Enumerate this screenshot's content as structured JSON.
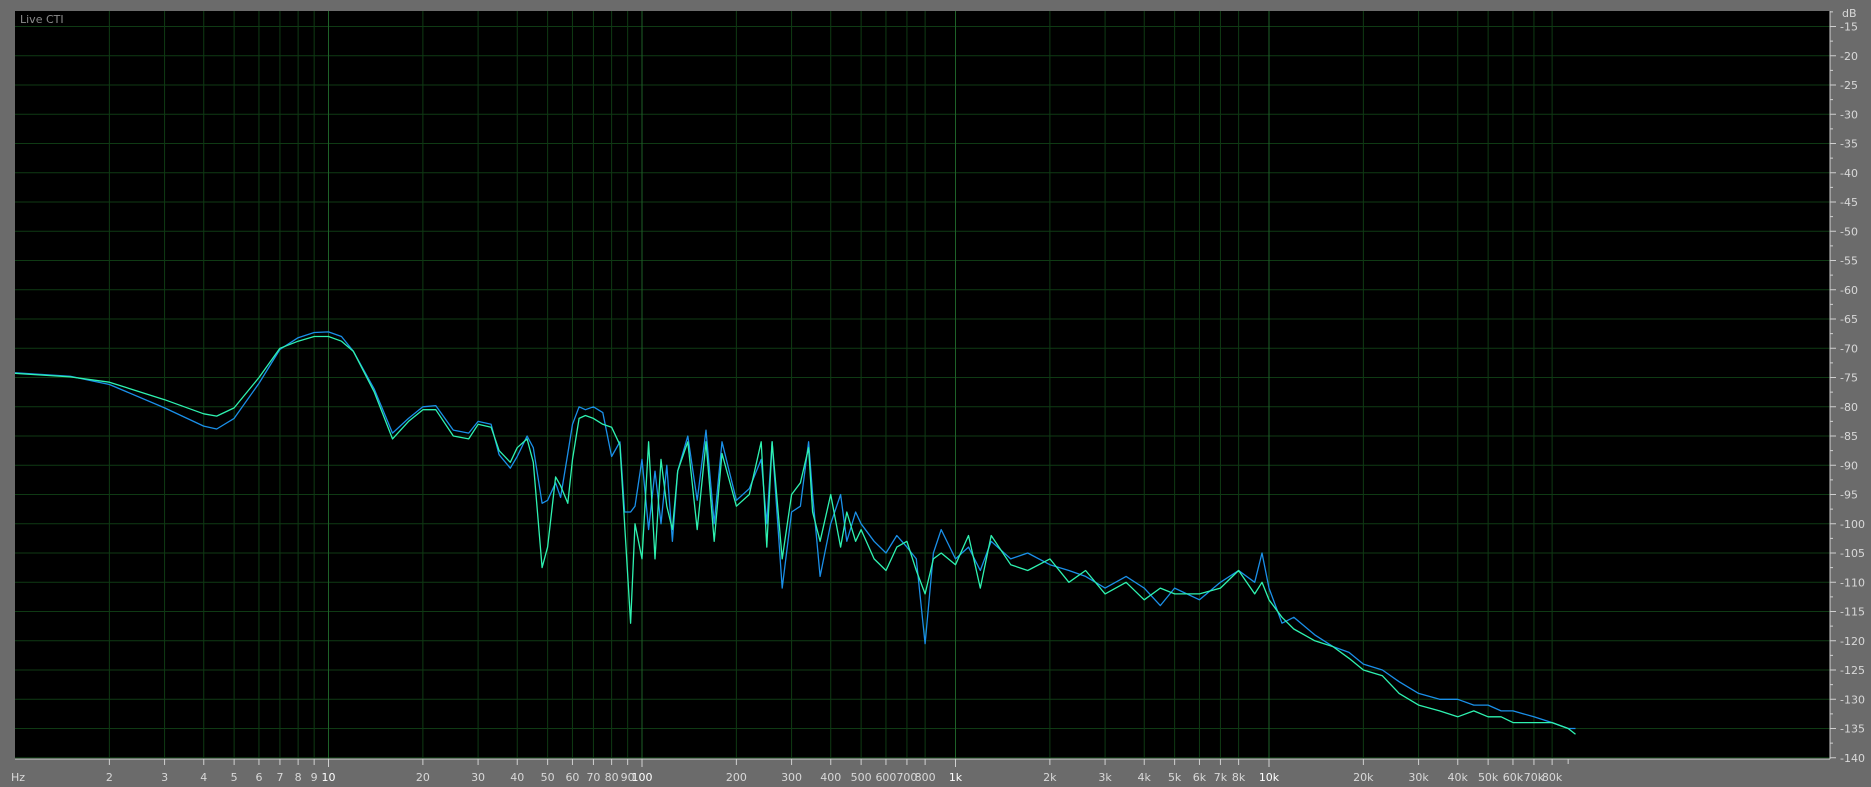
{
  "panel": {
    "mode_label": "Live CTI"
  },
  "colors": {
    "background": "#000000",
    "frame": "#6b6b6b",
    "grid_minor": "#0f3a14",
    "grid_major": "#1e6128",
    "axis_text": "#d8d8d8",
    "series_left": "#1a8fe8",
    "series_right": "#2ef2b0"
  },
  "chart_data": {
    "type": "line",
    "xscale": "log",
    "xunit_label": "Hz",
    "yunit_label": "dB",
    "xlim": [
      1,
      100000
    ],
    "ylim": [
      -140,
      -12
    ],
    "grid": true,
    "x_ticks": [
      {
        "value": 2,
        "label": "2"
      },
      {
        "value": 3,
        "label": "3"
      },
      {
        "value": 4,
        "label": "4"
      },
      {
        "value": 5,
        "label": "5"
      },
      {
        "value": 6,
        "label": "6"
      },
      {
        "value": 7,
        "label": "7"
      },
      {
        "value": 8,
        "label": "8"
      },
      {
        "value": 9,
        "label": "9"
      },
      {
        "value": 10,
        "label": "10",
        "major": true
      },
      {
        "value": 20,
        "label": "20"
      },
      {
        "value": 30,
        "label": "30"
      },
      {
        "value": 40,
        "label": "40"
      },
      {
        "value": 50,
        "label": "50"
      },
      {
        "value": 60,
        "label": "60"
      },
      {
        "value": 70,
        "label": "70"
      },
      {
        "value": 80,
        "label": "80"
      },
      {
        "value": 90,
        "label": "90"
      },
      {
        "value": 100,
        "label": "100",
        "major": true
      },
      {
        "value": 200,
        "label": "200"
      },
      {
        "value": 300,
        "label": "300"
      },
      {
        "value": 400,
        "label": "400"
      },
      {
        "value": 500,
        "label": "500"
      },
      {
        "value": 600,
        "label": "600"
      },
      {
        "value": 700,
        "label": "700"
      },
      {
        "value": 800,
        "label": "800"
      },
      {
        "value": 1000,
        "label": "1k",
        "major": true
      },
      {
        "value": 2000,
        "label": "2k"
      },
      {
        "value": 3000,
        "label": "3k"
      },
      {
        "value": 4000,
        "label": "4k"
      },
      {
        "value": 5000,
        "label": "5k"
      },
      {
        "value": 6000,
        "label": "6k"
      },
      {
        "value": 7000,
        "label": "7k"
      },
      {
        "value": 8000,
        "label": "8k"
      },
      {
        "value": 10000,
        "label": "10k",
        "major": true
      },
      {
        "value": 20000,
        "label": "20k"
      },
      {
        "value": 30000,
        "label": "30k"
      },
      {
        "value": 40000,
        "label": "40k"
      },
      {
        "value": 50000,
        "label": "50k"
      },
      {
        "value": 60000,
        "label": "60k"
      },
      {
        "value": 70000,
        "label": "70k"
      },
      {
        "value": 80000,
        "label": "80k"
      }
    ],
    "y_ticks": [
      -15,
      -20,
      -25,
      -30,
      -35,
      -40,
      -45,
      -50,
      -55,
      -60,
      -65,
      -70,
      -75,
      -80,
      -85,
      -90,
      -95,
      -100,
      -105,
      -110,
      -115,
      -120,
      -125,
      -130,
      -135,
      -140
    ],
    "series": [
      {
        "color": "#1a8fe8",
        "x": [
          1,
          1.5,
          2,
          3,
          4,
          4.4,
          5,
          6,
          7,
          8,
          9,
          10,
          11,
          12,
          14,
          16,
          18,
          20,
          22,
          25,
          28,
          30,
          33,
          35,
          38,
          40,
          43,
          45,
          48,
          50,
          53,
          55,
          58,
          60,
          63,
          66,
          70,
          75,
          80,
          85,
          88,
          92,
          95,
          100,
          105,
          110,
          115,
          120,
          125,
          130,
          140,
          150,
          160,
          170,
          180,
          200,
          220,
          240,
          250,
          260,
          280,
          300,
          320,
          340,
          350,
          370,
          400,
          430,
          450,
          480,
          500,
          550,
          600,
          650,
          700,
          750,
          800,
          850,
          900,
          1000,
          1100,
          1200,
          1300,
          1500,
          1700,
          2000,
          2300,
          2600,
          3000,
          3500,
          4000,
          4500,
          5000,
          6000,
          7000,
          8000,
          9000,
          9500,
          10000,
          11000,
          12000,
          14000,
          16000,
          18000,
          20000,
          23000,
          26000,
          30000,
          35000,
          40000,
          45000,
          50000,
          55000,
          60000,
          70000,
          80000,
          90000,
          95000
        ],
        "y": [
          -74.2,
          -74.8,
          -76.2,
          -80.2,
          -83.3,
          -83.8,
          -82,
          -76,
          -70.2,
          -68.2,
          -67.3,
          -67.2,
          -68,
          -70.5,
          -77,
          -84.5,
          -82,
          -80,
          -79.8,
          -84,
          -84.5,
          -82.5,
          -83,
          -88.2,
          -90.5,
          -88.5,
          -85,
          -87,
          -96.5,
          -96,
          -93,
          -95.5,
          -88,
          -83,
          -80,
          -80.5,
          -80,
          -81,
          -88.5,
          -86,
          -98,
          -98,
          -97,
          -89,
          -101,
          -91,
          -100,
          -90,
          -103,
          -91,
          -85,
          -96,
          -84,
          -100,
          -86,
          -96,
          -94,
          -89,
          -100,
          -86,
          -111,
          -98,
          -97,
          -86,
          -95,
          -109,
          -100,
          -95,
          -103,
          -98,
          -100,
          -103,
          -105,
          -102,
          -104,
          -106,
          -120.5,
          -105,
          -101,
          -106,
          -104,
          -108,
          -103,
          -106,
          -105,
          -107,
          -108,
          -109,
          -111,
          -109,
          -111,
          -114,
          -111,
          -113,
          -110,
          -108,
          -110,
          -105,
          -111,
          -117,
          -116,
          -119,
          -121,
          -122,
          -124,
          -125,
          -127,
          -129,
          -130,
          -130,
          -131,
          -131,
          -132,
          -132,
          -133,
          -134,
          -135,
          -135
        ]
      },
      {
        "color": "#2ef2b0",
        "x": [
          1,
          1.5,
          2,
          3,
          4,
          4.4,
          5,
          6,
          7,
          8,
          9,
          10,
          11,
          12,
          14,
          16,
          18,
          20,
          22,
          25,
          28,
          30,
          33,
          35,
          38,
          40,
          43,
          45,
          48,
          50,
          53,
          55,
          58,
          60,
          63,
          66,
          70,
          75,
          80,
          85,
          88,
          92,
          95,
          100,
          105,
          110,
          115,
          120,
          125,
          130,
          140,
          150,
          160,
          170,
          180,
          200,
          220,
          240,
          250,
          260,
          280,
          300,
          320,
          340,
          350,
          370,
          400,
          430,
          450,
          480,
          500,
          550,
          600,
          650,
          700,
          750,
          800,
          850,
          900,
          1000,
          1100,
          1200,
          1300,
          1500,
          1700,
          2000,
          2300,
          2600,
          3000,
          3500,
          4000,
          4500,
          5000,
          6000,
          7000,
          8000,
          9000,
          9500,
          10000,
          11000,
          12000,
          14000,
          16000,
          18000,
          20000,
          23000,
          26000,
          30000,
          35000,
          40000,
          45000,
          50000,
          55000,
          60000,
          70000,
          80000,
          90000,
          95000
        ],
        "y": [
          -74.3,
          -74.9,
          -75.8,
          -78.8,
          -81.2,
          -81.6,
          -80.2,
          -75,
          -70,
          -68.8,
          -68,
          -68,
          -68.8,
          -70.5,
          -77.5,
          -85.5,
          -82.5,
          -80.5,
          -80.5,
          -85,
          -85.5,
          -83,
          -83.5,
          -87.5,
          -89.5,
          -87,
          -85.5,
          -89.5,
          -107.5,
          -104,
          -92,
          -93.5,
          -96.5,
          -89,
          -82,
          -81.5,
          -82,
          -83,
          -83.5,
          -86.5,
          -100,
          -117,
          -100,
          -106,
          -86,
          -106,
          -89,
          -97,
          -101,
          -91,
          -86,
          -101,
          -86,
          -103,
          -88,
          -97,
          -95,
          -86,
          -104,
          -86,
          -106,
          -95,
          -93,
          -87,
          -98,
          -103,
          -95,
          -104,
          -98,
          -103,
          -101,
          -106,
          -108,
          -104,
          -103,
          -108,
          -112,
          -106,
          -105,
          -107,
          -102,
          -111,
          -102,
          -107,
          -108,
          -106,
          -110,
          -108,
          -112,
          -110,
          -113,
          -111,
          -112,
          -112,
          -111,
          -108,
          -112,
          -110,
          -113,
          -116,
          -118,
          -120,
          -121,
          -123,
          -125,
          -126,
          -129,
          -131,
          -132,
          -133,
          -132,
          -133,
          -133,
          -134,
          -134,
          -134,
          -135,
          -136
        ]
      }
    ]
  }
}
